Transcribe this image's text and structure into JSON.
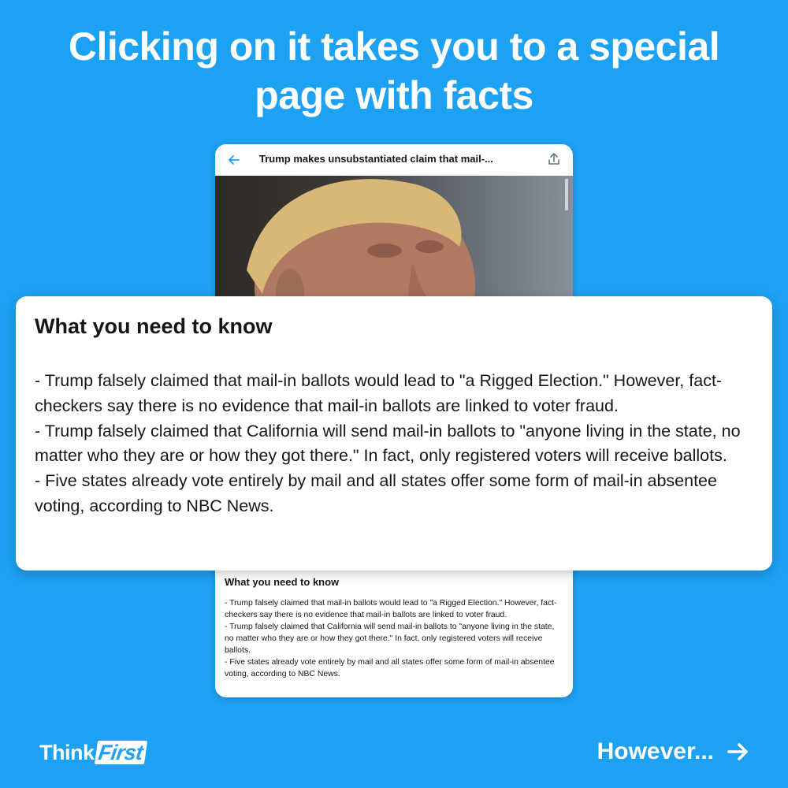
{
  "headline": "Clicking on it takes you to a special page with facts",
  "phone": {
    "title": "Trump makes unsubstantiated claim that mail-...",
    "icons": {
      "back": "back-arrow-icon",
      "share": "share-icon"
    },
    "section_heading": "What you need to know",
    "bullets": [
      "- Trump falsely claimed that mail-in ballots would lead to \"a Rigged Election.\" However, fact-checkers say there is no evidence that mail-in ballots are linked to voter fraud.",
      "- Trump falsely claimed that California will send mail-in ballots to \"anyone living in the state, no matter who they are or how they got there.\" In fact, only registered voters will receive ballots.",
      "- Five states already vote entirely by mail and all states offer some form of mail-in absentee voting, according to NBC News."
    ]
  },
  "overlay": {
    "heading": "What you need to know",
    "bullets": [
      "- Trump falsely claimed that mail-in ballots would lead to \"a Rigged Election.\" However, fact-checkers say there is no evidence that mail-in ballots are linked to voter fraud.",
      "- Trump falsely claimed that California will send mail-in ballots to \"anyone living in the state, no matter who they are or how they got there.\" In fact, only registered voters will receive ballots.",
      "- Five states already vote entirely by mail and all states offer some form of mail-in absentee voting, according to NBC News."
    ]
  },
  "footer": {
    "logo_think": "Think",
    "logo_first": "First",
    "next_label": "However...",
    "next_icon": "arrow-right-icon"
  },
  "colors": {
    "background": "#1da1f2",
    "card": "#ffffff",
    "text": "#14171a",
    "accent": "#1da1f2"
  }
}
